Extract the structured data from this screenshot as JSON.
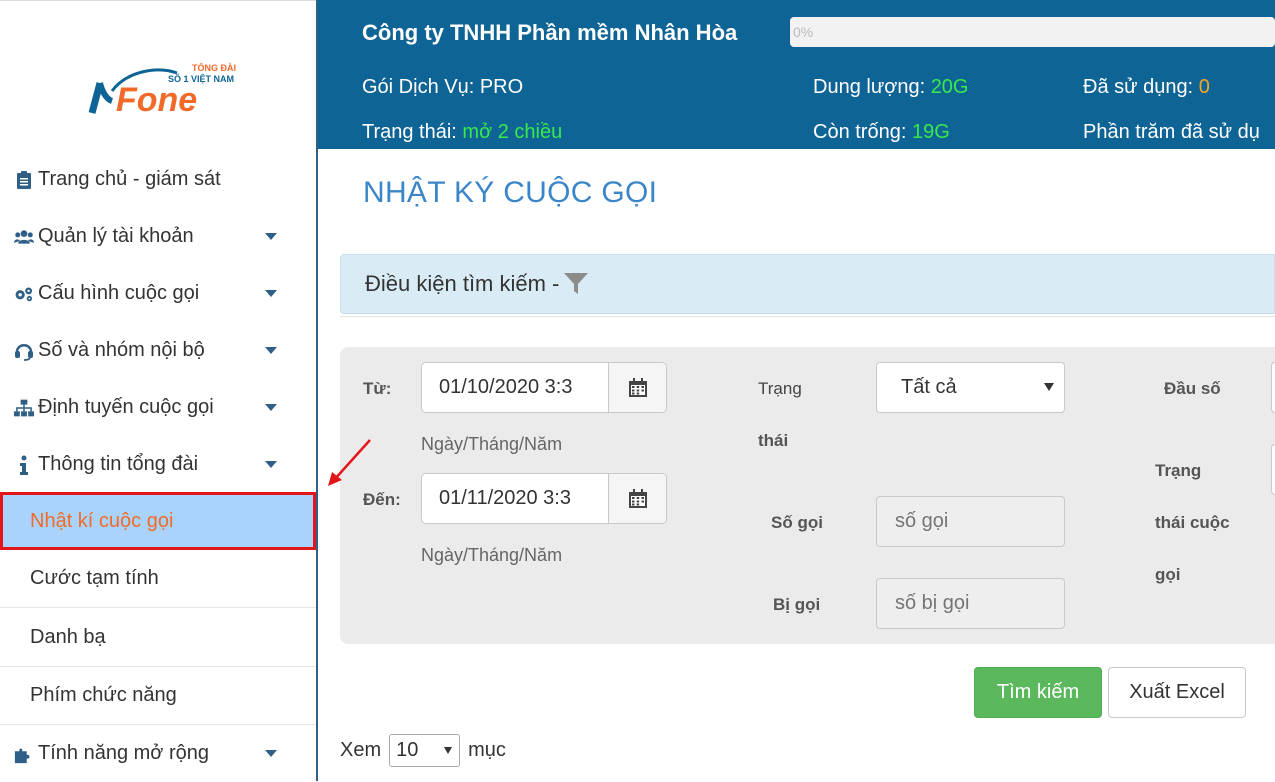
{
  "logo": {
    "brand": "vFone",
    "tagline_line1": "TỔNG ĐÀI",
    "tagline_line2": "SỐ 1 VIỆT NAM"
  },
  "sidebar": {
    "items": [
      {
        "label": "Trang chủ - giám sát",
        "icon": "clipboard-icon",
        "has_caret": false
      },
      {
        "label": "Quản lý tài khoản",
        "icon": "users-icon",
        "has_caret": true
      },
      {
        "label": "Cấu hình cuộc gọi",
        "icon": "cogs-icon",
        "has_caret": true
      },
      {
        "label": "Số và nhóm nội bộ",
        "icon": "headset-icon",
        "has_caret": true
      },
      {
        "label": "Định tuyến cuộc gọi",
        "icon": "sitemap-icon",
        "has_caret": true
      },
      {
        "label": "Thông tin tổng đài",
        "icon": "info-icon",
        "has_caret": true
      }
    ],
    "sub_items": [
      {
        "label": "Nhật kí cuộc gọi",
        "active": true
      },
      {
        "label": "Cước tạm tính",
        "active": false
      },
      {
        "label": "Danh bạ",
        "active": false
      },
      {
        "label": "Phím chức năng",
        "active": false
      }
    ],
    "last_item": {
      "label": "Tính năng mở rộng",
      "icon": "puzzle-icon"
    }
  },
  "header": {
    "company": "Công ty TNHH Phần mềm Nhân Hòa",
    "progress_text": "0%",
    "progress_value": 0,
    "package_label": "Gói Dịch Vụ: PRO",
    "status_label": "Trạng thái: ",
    "status_value": "mở 2 chiều",
    "capacity_label": "Dung lượng: ",
    "capacity_value": "20G",
    "free_label": "Còn trống: ",
    "free_value": "19G",
    "used_label": "Đã sử dụng: ",
    "used_value": "0",
    "percent_label": "Phần trăm đã sử dụ"
  },
  "main": {
    "title": "NHẬT KÝ CUỘC GỌI",
    "search_header": "Điều kiện tìm kiếm - ",
    "filters": {
      "from_label": "Từ:",
      "from_value": "01/10/2020 3:3",
      "to_label": "Đến:",
      "to_value": "01/11/2020 3:3",
      "date_hint": "Ngày/Tháng/Năm",
      "status_label_1": "Trạng",
      "status_label_2": "thái",
      "status_value": "Tất cả",
      "caller_label": "Số gọi",
      "caller_placeholder": "số gọi",
      "callee_label": "Bị gọi",
      "callee_placeholder": "số bị gọi",
      "prefix_label": "Đầu số",
      "call_status_label_1": "Trạng",
      "call_status_label_2": "thái cuộc",
      "call_status_label_3": "gọi"
    },
    "search_button": "Tìm kiếm",
    "export_button": "Xuất Excel",
    "show_label": "Xem",
    "show_value": "10",
    "show_suffix": "mục"
  },
  "colors": {
    "header_bg": "#0f6496",
    "accent_green": "#39e84a",
    "accent_orange": "#f5a623",
    "title_blue": "#3a86c8",
    "active_bg": "#a9d3fb",
    "active_text": "#f26a2a",
    "highlight_red": "#e3161c"
  }
}
